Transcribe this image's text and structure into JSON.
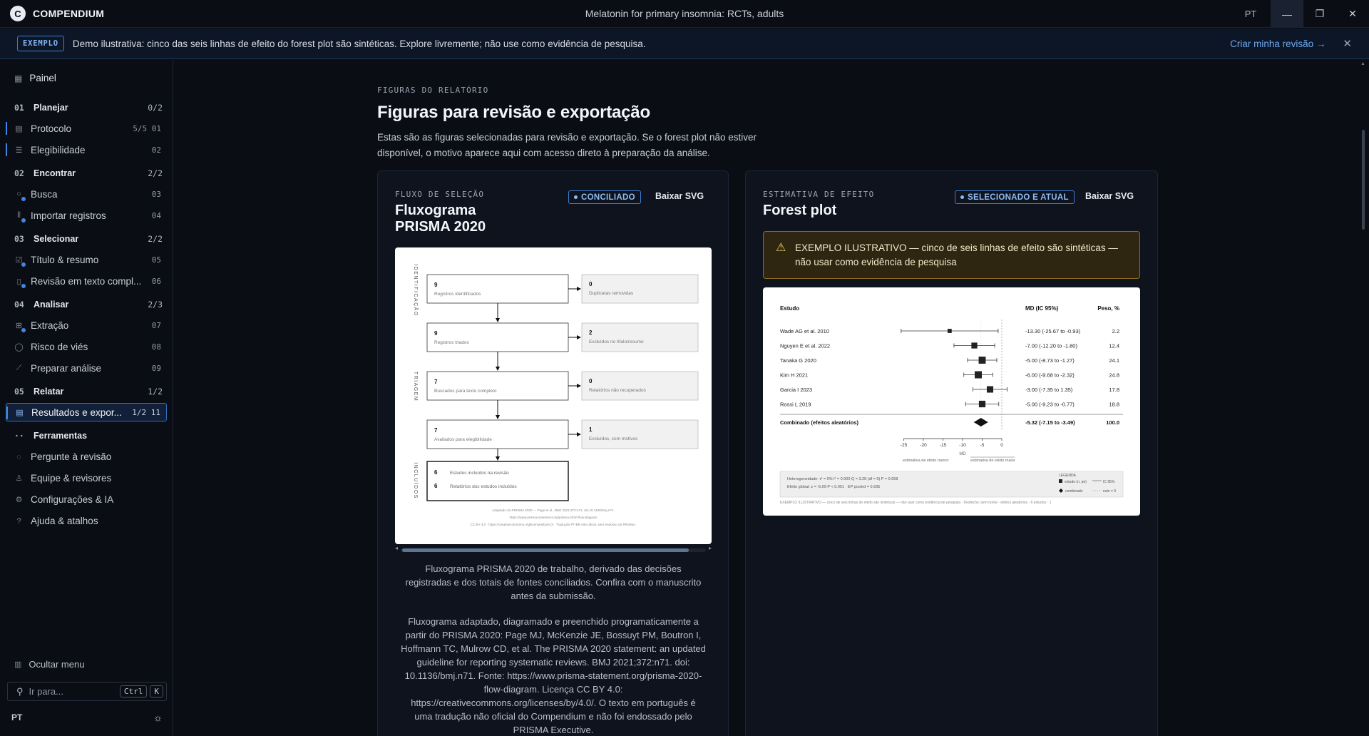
{
  "titlebar": {
    "brand": "COMPENDIUM",
    "logo_letter": "C",
    "doc_title": "Melatonin for primary insomnia: RCTs, adults",
    "lang": "PT"
  },
  "banner": {
    "tag": "EXEMPLO",
    "message": "Demo ilustrativa: cinco das seis linhas de efeito do forest plot são sintéticas. Explore livremente; não use como evidência de pesquisa.",
    "cta": "Criar minha revisão →"
  },
  "sidebar": {
    "top": "Painel",
    "groups": [
      {
        "num": "01",
        "label": "Planejar",
        "count": "0/2"
      },
      {
        "num": "02",
        "label": "Encontrar",
        "count": "2/2"
      },
      {
        "num": "03",
        "label": "Selecionar",
        "count": "2/2"
      },
      {
        "num": "04",
        "label": "Analisar",
        "count": "2/3"
      },
      {
        "num": "05",
        "label": "Relatar",
        "count": "1/2"
      },
      {
        "num": "··",
        "label": "Ferramentas",
        "count": ""
      }
    ],
    "items": [
      {
        "label": "Protocolo",
        "meta": "5/5 01"
      },
      {
        "label": "Elegibilidade",
        "meta": "02"
      },
      {
        "label": "Busca",
        "meta": "03"
      },
      {
        "label": "Importar registros",
        "meta": "04"
      },
      {
        "label": "Título & resumo",
        "meta": "05"
      },
      {
        "label": "Revisão em texto compl...",
        "meta": "06"
      },
      {
        "label": "Extração",
        "meta": "07"
      },
      {
        "label": "Risco de viés",
        "meta": "08"
      },
      {
        "label": "Preparar análise",
        "meta": "09"
      },
      {
        "label": "Resultados e expor...",
        "meta": "1/2 11"
      }
    ],
    "tools": [
      "Pergunte à revisão",
      "Equipe & revisores",
      "Configurações & IA",
      "Ajuda & atalhos"
    ],
    "hide_menu": "Ocultar menu",
    "goto_placeholder": "Ir para...",
    "shortcut_1": "Ctrl",
    "shortcut_2": "K",
    "footer_lang": "PT"
  },
  "section": {
    "eyebrow": "FIGURAS DO RELATÓRIO",
    "title": "Figuras para revisão e exportação",
    "description": "Estas são as figuras selecionadas para revisão e exportação. Se o forest plot não estiver disponível, o motivo aparece aqui com acesso direto à preparação da análise."
  },
  "prisma_card": {
    "eyebrow": "FLUXO DE SELEÇÃO",
    "title_1": "Fluxograma",
    "title_2": "PRISMA 2020",
    "badge": "CONCILIADO",
    "download": "Baixar SVG",
    "stages": [
      "IDENTIFICAÇÃO",
      "TRIAGEM",
      "INCLUÍDOS"
    ],
    "boxes": [
      {
        "n": "9",
        "label": "Registros identificados"
      },
      {
        "n": "9",
        "label": "Registros triados"
      },
      {
        "n": "7",
        "label": "Buscados para texto completo"
      },
      {
        "n": "7",
        "label": "Avaliados para elegibilidade"
      }
    ],
    "side_boxes": [
      {
        "n": "0",
        "label": "Duplicatas removidas"
      },
      {
        "n": "2",
        "label": "Excluídos no título/resumo"
      },
      {
        "n": "0",
        "label": "Relatórios não recuperados"
      },
      {
        "n": "1",
        "label": "Excluídos, com motivos"
      }
    ],
    "included": [
      {
        "n": "6",
        "label": "Estudos incluídos na revisão"
      },
      {
        "n": "6",
        "label": "Relatórios dos estudos incluídos"
      }
    ],
    "fig_footer_1": "Adaptado do PRISMA 2020 — Page et al., BMJ 2021;372:n71. doi:10.1136/bmj.n71.",
    "fig_footer_2": "https://www.prisma-statement.org/prisma-2020-flow-diagram",
    "fig_footer_3": "CC BY 4.0 · https://creativecommons.org/licenses/by/4.0/ · Tradução PT-BR não oficial, sem endosso do PRISMA.",
    "caption_1": "Fluxograma PRISMA 2020 de trabalho, derivado das decisões registradas e dos totais de fontes conciliados. Confira com o manuscrito antes da submissão.",
    "caption_2": "Fluxograma adaptado, diagramado e preenchido programaticamente a partir do PRISMA 2020: Page MJ, McKenzie JE, Bossuyt PM, Boutron I, Hoffmann TC, Mulrow CD, et al. The PRISMA 2020 statement: an updated guideline for reporting systematic reviews. BMJ 2021;372:n71. doi: 10.1136/bmj.n71. Fonte: https://www.prisma-statement.org/prisma-2020-flow-diagram. Licença CC BY 4.0: https://creativecommons.org/licenses/by/4.0/. O texto em português é uma tradução não oficial do Compendium e não foi endossado pelo PRISMA Executive."
  },
  "forest_card": {
    "eyebrow": "ESTIMATIVA DE EFEITO",
    "title": "Forest plot",
    "badge": "SELECIONADO E ATUAL",
    "download": "Baixar SVG",
    "warning": "EXEMPLO ILUSTRATIVO — cinco de seis linhas de efeito são sintéticas — não usar como evidência de pesquisa",
    "hetero": "Heterogeneidade: τ² = 0%  I² = 0.000  Q = 3.28 (df = 5)  P = 0.658",
    "overall_test": "Efeito global: z = -5.69  P < 0.001 · EP pooled = 0.935",
    "legend_title": "LEGENDA",
    "legend_study": "estudo (n. pe)",
    "legend_ci": "IC 95%",
    "legend_pooled": "combinado",
    "legend_null": "nulo = 0",
    "footer": "EXEMPLO ILUSTRATIVO — cinco de seis linhas de efeito são sintéticas — não usar como evidência de pesquisa · Desfecho: sem nome · efeitos aleatórios · 6 estudos · 1"
  },
  "chart_data": {
    "type": "scatter",
    "subtype": "forest",
    "col_study": "Estudo",
    "col_md": "MD (IC 95%)",
    "col_weight": "Peso, %",
    "xlabel": "MD",
    "xlabel_left": "estimativa de efeito menor",
    "xlabel_right": "estimativa de efeito maior",
    "xlim": [
      -30,
      0
    ],
    "xticks": [
      -25,
      -20,
      -15,
      -10,
      -5,
      0
    ],
    "null_value": 0,
    "studies": [
      {
        "name": "Wade AG et al. 2010",
        "md": -13.3,
        "lo": -25.67,
        "hi": -0.93,
        "ci_text": "-13.30 (-25.67 to -0.93)",
        "weight": 2.2
      },
      {
        "name": "Nguyen E et al. 2022",
        "md": -7.0,
        "lo": -12.2,
        "hi": -1.8,
        "ci_text": "-7.00 (-12.20 to -1.80)",
        "weight": 12.4
      },
      {
        "name": "Tanaka G 2020",
        "md": -5.0,
        "lo": -8.73,
        "hi": -1.27,
        "ci_text": "-5.00 (-8.73 to -1.27)",
        "weight": 24.1
      },
      {
        "name": "Kim H 2021",
        "md": -6.0,
        "lo": -9.68,
        "hi": -2.32,
        "ci_text": "-6.00 (-9.68 to -2.32)",
        "weight": 24.8
      },
      {
        "name": "Garcia I 2023",
        "md": -3.0,
        "lo": -7.35,
        "hi": 1.35,
        "ci_text": "-3.00 (-7.35 to 1.35)",
        "weight": 17.8
      },
      {
        "name": "Rossi L 2019",
        "md": -5.0,
        "lo": -9.23,
        "hi": -0.77,
        "ci_text": "-5.00 (-9.23 to -0.77)",
        "weight": 18.8
      }
    ],
    "pooled": {
      "name": "Combinado (efeitos aleatórios)",
      "md": -5.32,
      "lo": -7.15,
      "hi": -3.49,
      "ci_text": "-5.32 (-7.15 to -3.49)",
      "weight": 100.0
    }
  }
}
